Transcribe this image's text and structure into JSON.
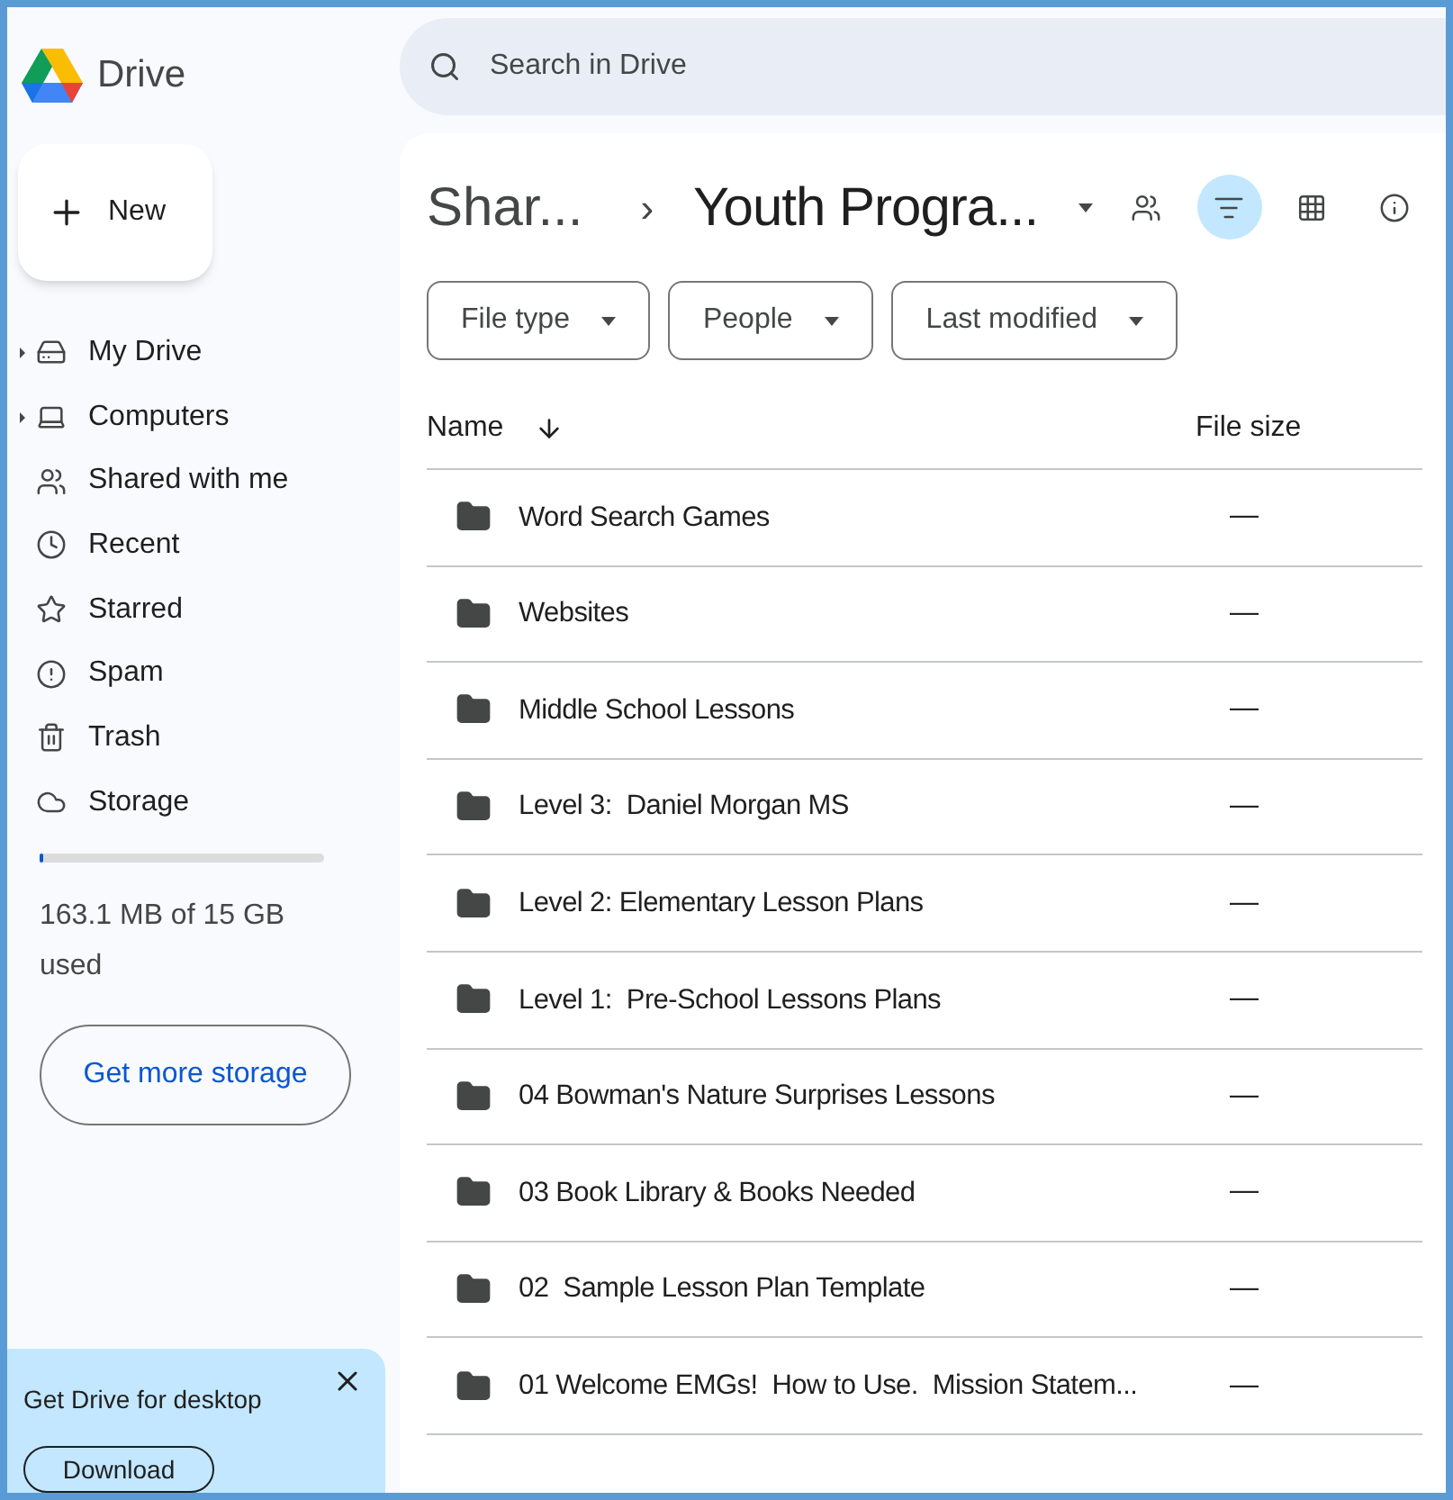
{
  "app": {
    "name": "Drive"
  },
  "search": {
    "placeholder": "Search in Drive"
  },
  "new_button": {
    "label": "New"
  },
  "sidebar": {
    "items": [
      {
        "label": "My Drive",
        "kind": "drive",
        "expanded": false
      },
      {
        "label": "Computers",
        "kind": "computers",
        "expanded": false
      },
      {
        "label": "Shared with me",
        "kind": "shared"
      },
      {
        "label": "Recent",
        "kind": "recent"
      },
      {
        "label": "Starred",
        "kind": "starred"
      },
      {
        "label": "Spam",
        "kind": "spam"
      },
      {
        "label": "Trash",
        "kind": "trash"
      },
      {
        "label": "Storage",
        "kind": "storage"
      }
    ]
  },
  "storage": {
    "level": 0.01,
    "usage": "163.1 MB of 15 GB used",
    "button": "Get more storage"
  },
  "promo": {
    "title": "Get Drive for desktop",
    "button": "Download"
  },
  "breadcrumb": {
    "parent": "Shar...",
    "separator": "›",
    "current": "Youth Progra..."
  },
  "toolbar": [
    {
      "kind": "people",
      "selected": false
    },
    {
      "kind": "filter",
      "selected": true
    },
    {
      "kind": "grid",
      "selected": false
    },
    {
      "kind": "info",
      "selected": false
    }
  ],
  "filters": [
    "File type",
    "People",
    "Last modified"
  ],
  "table": {
    "columns": [
      "Name",
      "File size"
    ],
    "rows": [
      {
        "name": "Word Search Games",
        "size": "—"
      },
      {
        "name": "Websites",
        "size": "—"
      },
      {
        "name": "Middle School Lessons",
        "size": "—"
      },
      {
        "name": "Level 3:  Daniel Morgan MS",
        "size": "—"
      },
      {
        "name": "Level 2: Elementary Lesson Plans",
        "size": "—"
      },
      {
        "name": "Level 1:  Pre-School Lessons Plans",
        "size": "—"
      },
      {
        "name": "04 Bowman's Nature Surprises Lessons",
        "size": "—"
      },
      {
        "name": "03 Book Library & Books Needed",
        "size": "—"
      },
      {
        "name": "02  Sample Lesson Plan Template",
        "size": "—"
      },
      {
        "name": "01 Welcome EMGs!  How to Use.  Mission Statem...",
        "size": "—"
      }
    ]
  }
}
